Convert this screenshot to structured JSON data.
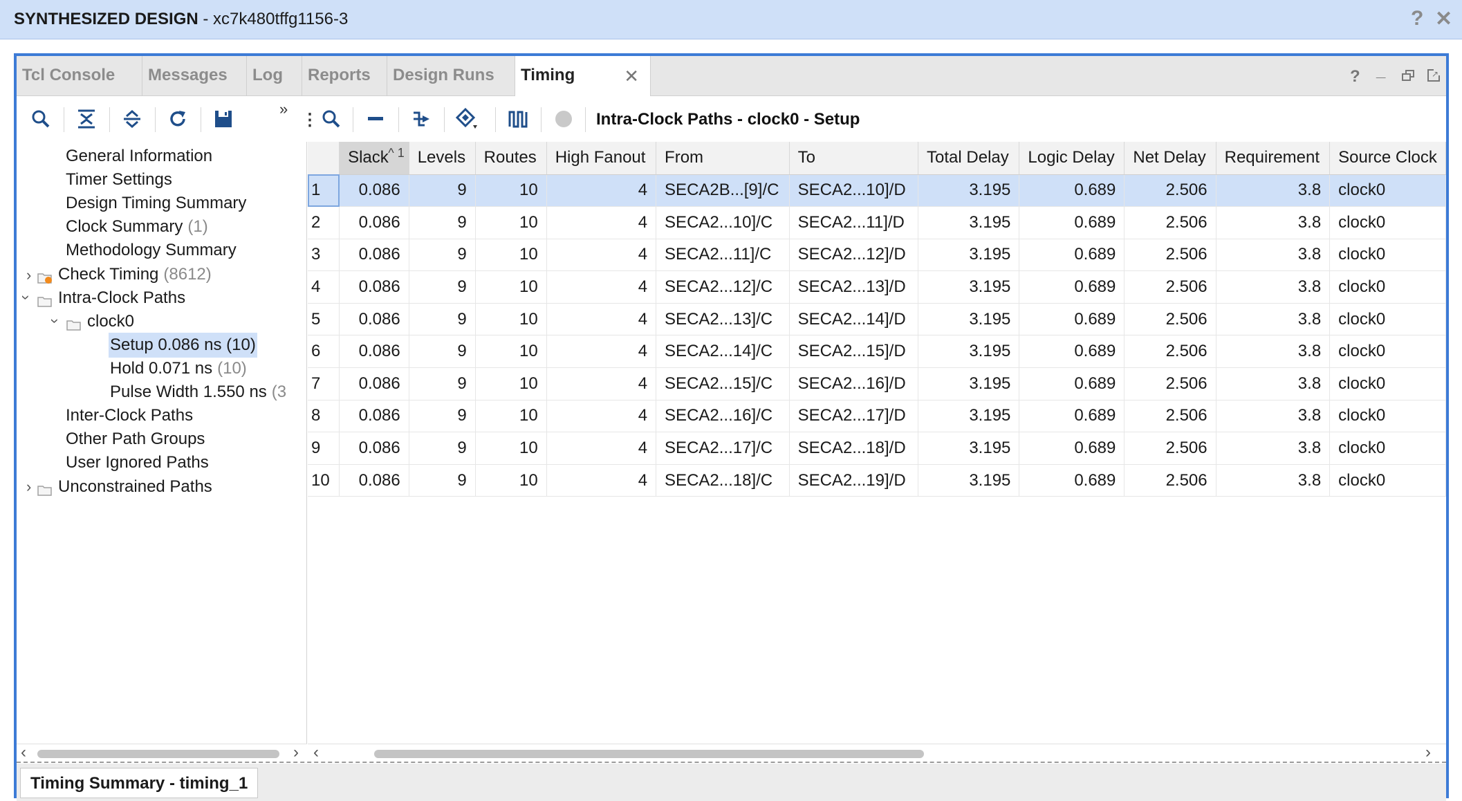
{
  "window": {
    "title_bold": "SYNTHESIZED DESIGN",
    "title_rest": " - xc7k480tffg1156-3",
    "help_icon": "?",
    "close_icon": "✕"
  },
  "tabs": [
    {
      "label": "Tcl Console"
    },
    {
      "label": "Messages"
    },
    {
      "label": "Log"
    },
    {
      "label": "Reports"
    },
    {
      "label": "Design Runs"
    },
    {
      "label": "Timing",
      "active": true
    }
  ],
  "panel_controls": [
    "?",
    "_",
    "restore",
    "float"
  ],
  "toolbar": {
    "breadcrumb": "Intra-Clock Paths - clock0 - Setup",
    "overflow": "»"
  },
  "tree": {
    "items": [
      {
        "label": "General Information",
        "count": ""
      },
      {
        "label": "Timer Settings",
        "count": ""
      },
      {
        "label": "Design Timing Summary",
        "count": ""
      },
      {
        "label": "Clock Summary",
        "count": "(1)"
      },
      {
        "label": "Methodology Summary",
        "count": ""
      },
      {
        "label": "Check Timing",
        "count": "(8612)"
      },
      {
        "label": "Intra-Clock Paths",
        "count": ""
      },
      {
        "label": "clock0",
        "count": ""
      },
      {
        "label": "Setup 0.086 ns (10)",
        "count": ""
      },
      {
        "label": "Hold 0.071 ns",
        "count": "(10)"
      },
      {
        "label": "Pulse Width 1.550 ns",
        "count": "(3"
      },
      {
        "label": "Inter-Clock Paths",
        "count": ""
      },
      {
        "label": "Other Path Groups",
        "count": ""
      },
      {
        "label": "User Ignored Paths",
        "count": ""
      },
      {
        "label": "Unconstrained Paths",
        "count": ""
      }
    ]
  },
  "table": {
    "sort_indicator": "1",
    "columns": [
      "",
      "Slack",
      "Levels",
      "Routes",
      "High Fanout",
      "From",
      "To",
      "Total Delay",
      "Logic Delay",
      "Net Delay",
      "Requirement",
      "Source Clock"
    ],
    "rows": [
      [
        "1",
        "0.086",
        "9",
        "10",
        "4",
        "SECA2B...[9]/C",
        "SECA2...10]/D",
        "3.195",
        "0.689",
        "2.506",
        "3.8",
        "clock0"
      ],
      [
        "2",
        "0.086",
        "9",
        "10",
        "4",
        "SECA2...10]/C",
        "SECA2...11]/D",
        "3.195",
        "0.689",
        "2.506",
        "3.8",
        "clock0"
      ],
      [
        "3",
        "0.086",
        "9",
        "10",
        "4",
        "SECA2...11]/C",
        "SECA2...12]/D",
        "3.195",
        "0.689",
        "2.506",
        "3.8",
        "clock0"
      ],
      [
        "4",
        "0.086",
        "9",
        "10",
        "4",
        "SECA2...12]/C",
        "SECA2...13]/D",
        "3.195",
        "0.689",
        "2.506",
        "3.8",
        "clock0"
      ],
      [
        "5",
        "0.086",
        "9",
        "10",
        "4",
        "SECA2...13]/C",
        "SECA2...14]/D",
        "3.195",
        "0.689",
        "2.506",
        "3.8",
        "clock0"
      ],
      [
        "6",
        "0.086",
        "9",
        "10",
        "4",
        "SECA2...14]/C",
        "SECA2...15]/D",
        "3.195",
        "0.689",
        "2.506",
        "3.8",
        "clock0"
      ],
      [
        "7",
        "0.086",
        "9",
        "10",
        "4",
        "SECA2...15]/C",
        "SECA2...16]/D",
        "3.195",
        "0.689",
        "2.506",
        "3.8",
        "clock0"
      ],
      [
        "8",
        "0.086",
        "9",
        "10",
        "4",
        "SECA2...16]/C",
        "SECA2...17]/D",
        "3.195",
        "0.689",
        "2.506",
        "3.8",
        "clock0"
      ],
      [
        "9",
        "0.086",
        "9",
        "10",
        "4",
        "SECA2...17]/C",
        "SECA2...18]/D",
        "3.195",
        "0.689",
        "2.506",
        "3.8",
        "clock0"
      ],
      [
        "10",
        "0.086",
        "9",
        "10",
        "4",
        "SECA2...18]/C",
        "SECA2...19]/D",
        "3.195",
        "0.689",
        "2.506",
        "3.8",
        "clock0"
      ]
    ]
  },
  "bottom_tab": "Timing Summary - timing_1",
  "colors": {
    "title_bg": "#cfe0f8",
    "panel_border": "#3d7bd6",
    "selection": "#cfe0f8",
    "toolbar_icon": "#1f4e8a"
  }
}
